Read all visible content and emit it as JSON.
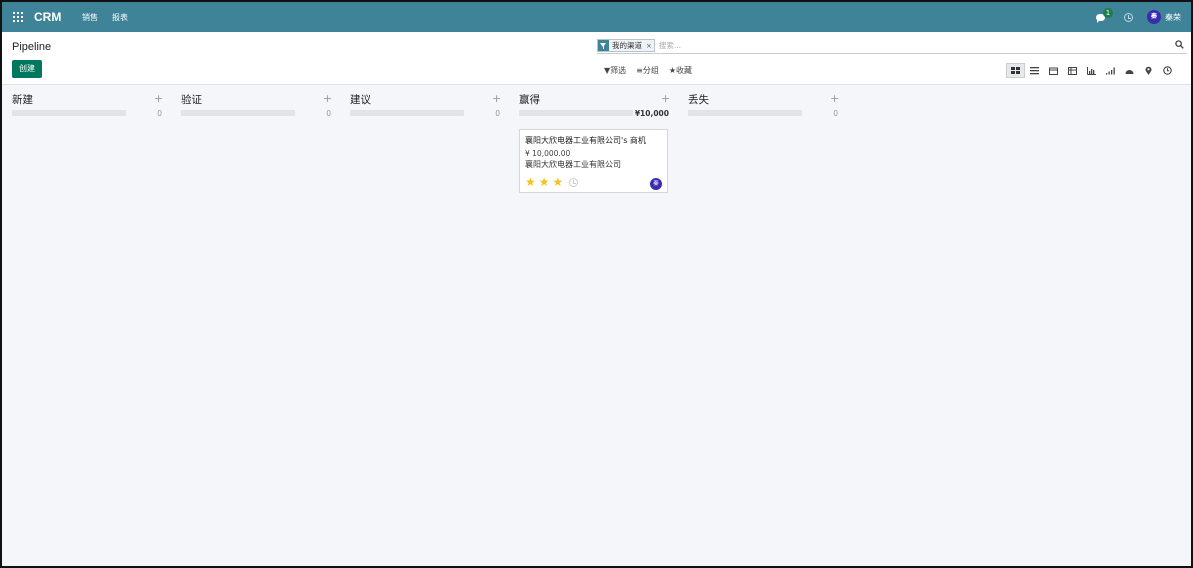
{
  "navbar": {
    "brand": "CRM",
    "menu": [
      "销售",
      "报表"
    ],
    "message_count": "1",
    "user_name": "秦荣",
    "user_initial": "秦",
    "icons": [
      "apps-icon",
      "chat-icon",
      "clock-icon",
      "avatar"
    ]
  },
  "control": {
    "title": "Pipeline",
    "create_label": "创建",
    "facet_label": "我的渠道",
    "facet_remove": "×",
    "search_placeholder": "搜索...",
    "filters": [
      "▼筛选",
      "≡分组",
      "★收藏"
    ],
    "views": [
      "kanban",
      "list",
      "calendar",
      "pivot",
      "graph",
      "cohort",
      "dashboard",
      "map",
      "activity"
    ]
  },
  "kanban": {
    "columns": [
      {
        "name": "新建",
        "total": "0"
      },
      {
        "name": "验证",
        "total": "0"
      },
      {
        "name": "建议",
        "total": "0"
      },
      {
        "name": "赢得",
        "total": "¥10,000"
      },
      {
        "name": "丢失",
        "total": "0"
      }
    ],
    "card": {
      "title": "襄阳大欣电器工业有限公司's 商机",
      "amount": "¥ 10,000.00",
      "company": "襄阳大欣电器工业有限公司",
      "priority_stars": 3,
      "avatar_initial": "秦"
    }
  },
  "colors": {
    "navbar": "#3f8398",
    "primary_button": "#00785d",
    "star": "#f3c31a",
    "avatar": "#3b2bb0"
  }
}
